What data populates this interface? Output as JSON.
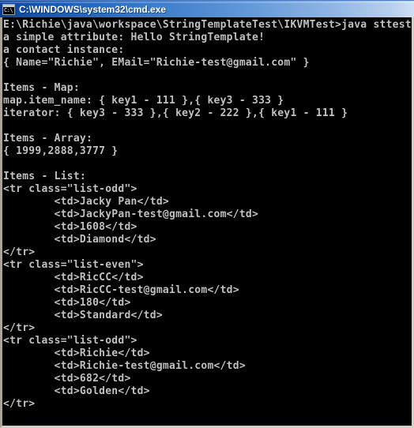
{
  "window": {
    "title": "C:\\WINDOWS\\system32\\cmd.exe",
    "icon": "cmd-console-icon",
    "icon_glyph": "C:\\",
    "titlebar_color_left": "#0b3e8f",
    "titlebar_color_right": "#cfdff5",
    "frame_color": "#d4d0c8"
  },
  "console": {
    "background_color": "#000000",
    "text_color": "#c0c0c0",
    "prompt": "E:\\Richie\\java\\workspace\\StringTemplateTest\\IKVMTest>",
    "command": "java sttest",
    "lines": [
      "E:\\Richie\\java\\workspace\\StringTemplateTest\\IKVMTest>java sttest",
      "a simple attribute: Hello StringTemplate!",
      "a contact instance:",
      "{ Name=\"Richie\", EMail=\"Richie-test@gmail.com\" }",
      "",
      "Items - Map:",
      "map.item_name: { key1 - 111 },{ key3 - 333 }",
      "iterator: { key3 - 333 },{ key2 - 222 },{ key1 - 111 }",
      "",
      "Items - Array:",
      "{ 1999,2888,3777 }",
      "",
      "Items - List:",
      "<tr class=\"list-odd\">",
      "        <td>Jacky Pan</td>",
      "        <td>JackyPan-test@gmail.com</td>",
      "        <td>1608</td>",
      "        <td>Diamond</td>",
      "</tr>",
      "<tr class=\"list-even\">",
      "        <td>RicCC</td>",
      "        <td>RicCC-test@gmail.com</td>",
      "        <td>180</td>",
      "        <td>Standard</td>",
      "</tr>",
      "<tr class=\"list-odd\">",
      "        <td>Richie</td>",
      "        <td>Richie-test@gmail.com</td>",
      "        <td>682</td>",
      "        <td>Golden</td>",
      "</tr>"
    ],
    "sections": {
      "simple_attribute": {
        "label": "a simple attribute:",
        "value": "Hello StringTemplate!"
      },
      "contact_instance": {
        "label": "a contact instance:",
        "name": "Richie",
        "email": "Richie-test@gmail.com"
      },
      "map": {
        "heading": "Items - Map:",
        "item_name_label": "map.item_name:",
        "item_name_entries": [
          {
            "key": "key1",
            "value": "111"
          },
          {
            "key": "key3",
            "value": "333"
          }
        ],
        "iterator_label": "iterator:",
        "iterator_entries": [
          {
            "key": "key3",
            "value": "333"
          },
          {
            "key": "key2",
            "value": "222"
          },
          {
            "key": "key1",
            "value": "111"
          }
        ]
      },
      "array": {
        "heading": "Items - Array:",
        "values": [
          "1999",
          "2888",
          "3777"
        ]
      },
      "list": {
        "heading": "Items - List:",
        "rows": [
          {
            "css_class": "list-odd",
            "name": "Jacky Pan",
            "email": "JackyPan-test@gmail.com",
            "number": "1608",
            "level": "Diamond"
          },
          {
            "css_class": "list-even",
            "name": "RicCC",
            "email": "RicCC-test@gmail.com",
            "number": "180",
            "level": "Standard"
          },
          {
            "css_class": "list-odd",
            "name": "Richie",
            "email": "Richie-test@gmail.com",
            "number": "682",
            "level": "Golden"
          }
        ]
      }
    }
  }
}
